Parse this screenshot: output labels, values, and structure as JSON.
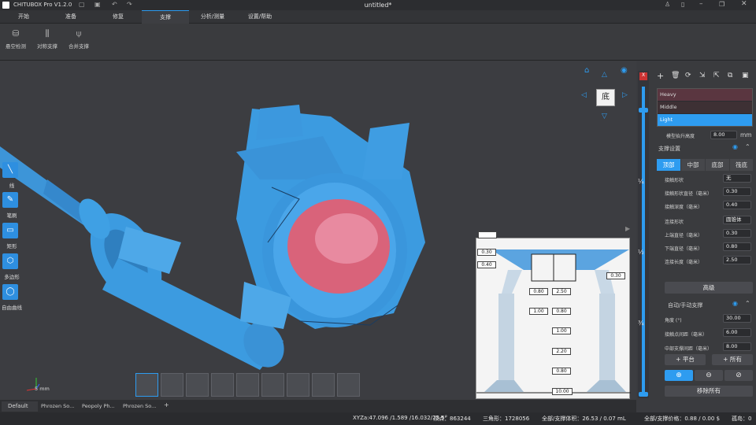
{
  "app": {
    "title_left": "CHITUBOX Pro V1.2.0",
    "document_title": "untitled*",
    "window_controls": [
      "user-icon",
      "help-icon",
      "minimize-icon",
      "restore-icon",
      "close-icon"
    ]
  },
  "menu": {
    "tabs": [
      "开始",
      "准备",
      "修复",
      "支撑",
      "分析/测量",
      "设置/帮助"
    ],
    "active": "支撑"
  },
  "toolbar": {
    "tools": [
      {
        "label": "悬空检测",
        "icon": "overhang-detect-icon"
      },
      {
        "label": "对称支撑",
        "icon": "symmetric-support-icon"
      },
      {
        "label": "合并支撑",
        "icon": "merge-support-icon"
      }
    ]
  },
  "left_tools": [
    {
      "label": "线",
      "icon": "line-icon"
    },
    {
      "label": "笔刷",
      "icon": "brush-icon"
    },
    {
      "label": "矩形",
      "icon": "rectangle-icon"
    },
    {
      "label": "多边形",
      "icon": "polygon-icon"
    },
    {
      "label": "自由曲线",
      "icon": "freehand-icon"
    }
  ],
  "axis": {
    "scale_label": "5 mm"
  },
  "view_cube": {
    "face_label": "底"
  },
  "slider_marks": [
    "¼",
    "½",
    "¾"
  ],
  "bottom_thumbnails": [
    "support-style-1",
    "support-style-2",
    "support-style-3",
    "support-style-4",
    "support-style-5",
    "support-style-6",
    "support-style-7",
    "support-style-8",
    "support-style-9"
  ],
  "diagram": {
    "labels": [
      "0.30",
      "0.40",
      "0.30",
      "0.80",
      "2.50",
      "1.00",
      "0.80",
      "1.00",
      "2.20",
      "0.80",
      "10.00"
    ]
  },
  "sidebar": {
    "presets": [
      "Heavy",
      "Middle",
      "Light"
    ],
    "active_preset": "Light",
    "lift_height": {
      "label": "模型抬升高度",
      "value": "8.00",
      "unit": "mm"
    },
    "support_settings_title": "支撑设置",
    "part_tabs": [
      "顶部",
      "中部",
      "底部",
      "筏底"
    ],
    "active_part": "顶部",
    "rows": [
      {
        "label": "接触形状",
        "value": "无"
      },
      {
        "label": "接触形状直径（毫米）",
        "value": "0.30"
      },
      {
        "label": "接触深度（毫米）",
        "value": "0.40"
      },
      {
        "label": "连接形状",
        "value": "圆锥体"
      },
      {
        "label": "上端直径（毫米）",
        "value": "0.30"
      },
      {
        "label": "下端直径（毫米）",
        "value": "0.80"
      },
      {
        "label": "连接长度（毫米）",
        "value": "2.50"
      }
    ],
    "advanced_button": "高级",
    "auto_manual_title": "自动/手动支撑",
    "auto_rows": [
      {
        "label": "角度 (°)",
        "value": "30.00"
      },
      {
        "label": "接触点间距（毫米）",
        "value": "6.00"
      },
      {
        "label": "中部支撑间距（毫米）",
        "value": "8.00"
      }
    ],
    "platform_button": "+ 平台",
    "all_button": "+ 所有",
    "remove_all_button": "移除所有"
  },
  "file_tabs": [
    "Default",
    "Phrozen So...",
    "Peopoly Ph...",
    "Phrozen So..."
  ],
  "status": {
    "coords": "XYZa:47.096 /1.589 /16.032/23.5°",
    "vertices": "顶点：863244",
    "triangles": "三角形：1728056",
    "volume": "全部/支撑体积：26.53 / 0.07 mL",
    "price": "全部/支撑价格：0.88 / 0.00 $",
    "islands": "孤岛：0"
  },
  "colors": {
    "accent": "#2e9cf0",
    "model": "#3c9be0",
    "highlight": "#d9637a"
  }
}
